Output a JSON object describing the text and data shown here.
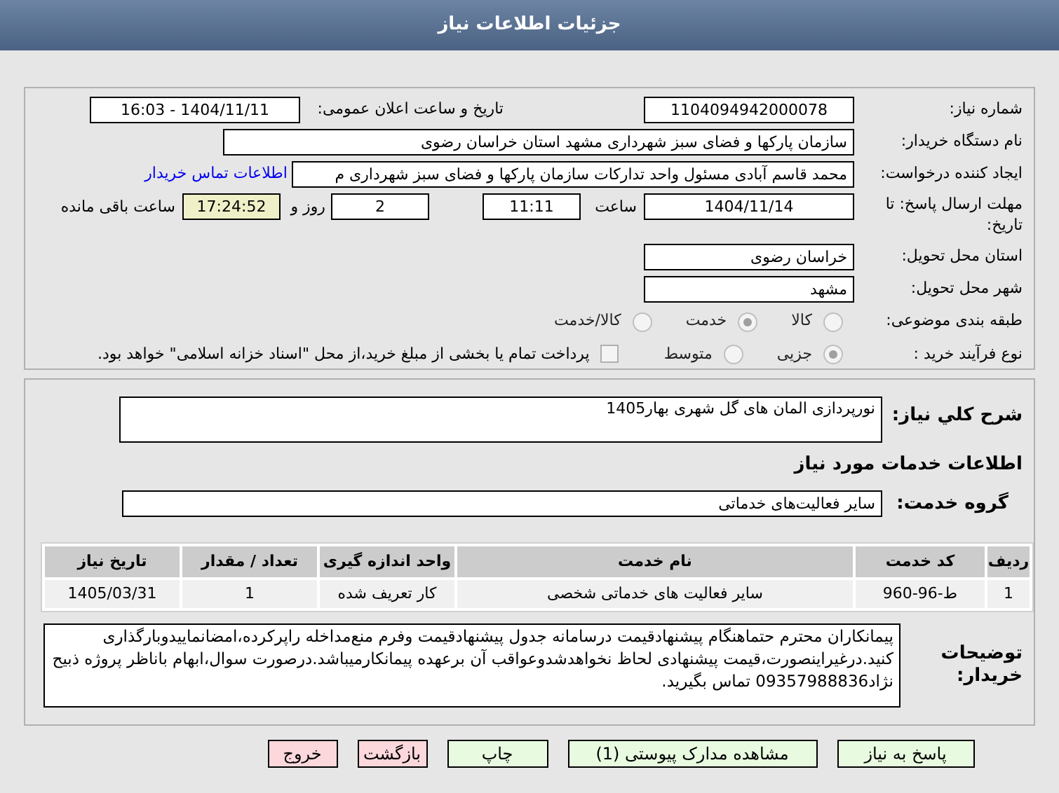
{
  "header": {
    "title": "جزئیات اطلاعات نیاز"
  },
  "need_number": {
    "label": "شماره نیاز:",
    "value": "1104094942000078"
  },
  "announce": {
    "label": "تاریخ و ساعت اعلان عمومی:",
    "value": "1404/11/11 - 16:03"
  },
  "buyer": {
    "label": "نام دستگاه خریدار:",
    "value": "سازمان پارکها و فضای سبز شهرداری مشهد استان خراسان رضوی"
  },
  "creator": {
    "label": "ایجاد کننده درخواست:",
    "value": "محمد قاسم آبادی مسئول واحد تدارکات سازمان پارکها و فضای سبز شهرداری م",
    "link": "اطلاعات تماس خریدار"
  },
  "deadline": {
    "label": "مهلت ارسال پاسخ: تا تاریخ:",
    "date": "1404/11/14",
    "time_label": "ساعت",
    "time": "11:11",
    "days": "2",
    "days_label": "روز و",
    "remaining": "17:24:52",
    "remaining_label": "ساعت باقی مانده"
  },
  "province": {
    "label": "استان محل تحویل:",
    "value": "خراسان رضوی"
  },
  "city": {
    "label": "شهر محل تحویل:",
    "value": "مشهد"
  },
  "category": {
    "label": "طبقه بندی موضوعی:",
    "options": [
      {
        "label": "کالا",
        "selected": false
      },
      {
        "label": "خدمت",
        "selected": true
      },
      {
        "label": "کالا/خدمت",
        "selected": false
      }
    ]
  },
  "purchase": {
    "label": "نوع فرآیند خرید :",
    "options": [
      {
        "label": "جزیی",
        "selected": true
      },
      {
        "label": "متوسط",
        "selected": false
      }
    ],
    "payment": {
      "checked": false,
      "text": "پرداخت تمام یا بخشی از مبلغ خرید،از محل \"اسناد خزانه اسلامی\" خواهد بود."
    }
  },
  "description": {
    "label": "شرح کلي نياز:",
    "value": "نورپردازی المان های گل شهری بهار1405"
  },
  "services_title": "اطلاعات خدمات مورد نیاز",
  "service_group": {
    "label": "گروه خدمت:",
    "value": "سایر فعالیت‌های خدماتی"
  },
  "table": {
    "columns": [
      "ردیف",
      "کد خدمت",
      "نام خدمت",
      "واحد اندازه گیری",
      "تعداد / مقدار",
      "تاریخ نیاز"
    ],
    "rows": [
      [
        "1",
        "ط-96-960",
        "سایر فعالیت های خدماتی شخصی",
        "کار تعریف شده",
        "1",
        "1405/03/31"
      ]
    ]
  },
  "notes": {
    "label": "توضیحات خریدار:",
    "value": "پیمانکاران محترم حتماهنگام پیشنهادقیمت درسامانه جدول پیشنهادقیمت وفرم منع‌مداخله راپرکرده،امضانماییدوبارگذاری کنید.درغیراینصورت،قیمت پیشنهادی لحاظ نخواهدشدوعواقب آن برعهده پیمانکارمیباشد.درصورت سوال،ابهام باناظر پروژه ذبیح نژاد09357988836 تماس بگیرید."
  },
  "buttons": [
    {
      "label": "پاسخ به نیاز",
      "kind": "primary"
    },
    {
      "label": "مشاهده مدارک پیوستی (1)",
      "kind": "primary"
    },
    {
      "label": "چاپ",
      "kind": "primary"
    },
    {
      "label": "بازگشت",
      "kind": "danger"
    },
    {
      "label": "خروج",
      "kind": "danger"
    }
  ]
}
